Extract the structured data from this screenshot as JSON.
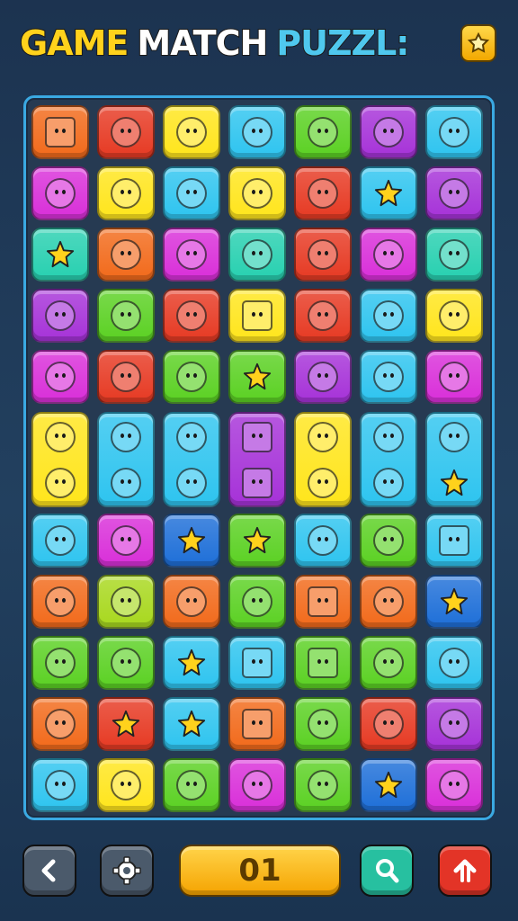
{
  "title": {
    "part1": "GAME",
    "part2": "MATCH",
    "part3": "PUZZL:"
  },
  "score": {
    "value": "01"
  },
  "colors": {
    "orange": "#f26a1b",
    "red": "#e63a23",
    "yellow": "#ffe51c",
    "cyan": "#2ec4ef",
    "green": "#5bd123",
    "purple": "#a632d8",
    "magenta": "#d92fd9",
    "teal": "#27d0b0",
    "lime": "#a8d81e",
    "blue": "#1e6fd8",
    "pink": "#ff4f9a"
  },
  "board": {
    "rows": [
      [
        "orange",
        "red",
        "yellow",
        "cyan",
        "green",
        "purple",
        "cyan"
      ],
      [
        "magenta",
        "yellow",
        "cyan",
        "yellow",
        "red",
        "cyan",
        "purple"
      ],
      [
        "teal",
        "orange",
        "magenta",
        "teal",
        "red",
        "magenta",
        "teal"
      ],
      [
        "purple",
        "green",
        "red",
        "yellow",
        "red",
        "cyan",
        "yellow"
      ],
      [
        "magenta",
        "red",
        "green",
        "green",
        "purple",
        "cyan",
        "magenta"
      ],
      [
        "yellow",
        "cyan",
        "cyan",
        "purple",
        "yellow",
        "cyan",
        "cyan"
      ],
      [
        "cyan",
        "magenta",
        "blue",
        "green",
        "cyan",
        "green",
        "cyan"
      ],
      [
        "orange",
        "lime",
        "orange",
        "green",
        "orange",
        "orange",
        "blue"
      ],
      [
        "green",
        "green",
        "cyan",
        "cyan",
        "green",
        "green",
        "cyan"
      ],
      [
        "orange",
        "red",
        "cyan",
        "orange",
        "green",
        "red",
        "purple"
      ],
      [
        "cyan",
        "yellow",
        "green",
        "magenta",
        "green",
        "blue",
        "magenta"
      ]
    ],
    "icons": [
      [
        "card-icon",
        "bomb-icon",
        "blob-icon",
        "heart-icon",
        "sun-icon",
        "cat-icon",
        "face-icon"
      ],
      [
        "drop-icon",
        "gear-icon",
        "coin-icon",
        "leaf-icon",
        "cat-icon",
        "star-icon",
        "cat-icon"
      ],
      [
        "star-icon",
        "ball-icon",
        "bird-icon",
        "fox-icon",
        "heart-icon",
        "mask-icon",
        "chick-icon"
      ],
      [
        "fruit-icon",
        "pear-icon",
        "balloon-icon",
        "box-icon",
        "sun-icon",
        "pen-icon",
        "pen-icon"
      ],
      [
        "cat-icon",
        "fish-icon",
        "shell-icon",
        "star-icon",
        "pen-icon",
        "swirl-icon",
        "cat-icon"
      ],
      [
        "owl-icon",
        "fox-icon",
        "egg-icon",
        "box-icon",
        "berry-icon",
        "swirl-icon",
        "face-icon"
      ],
      [
        "swirl-icon",
        "pen-icon",
        "star-icon",
        "star-icon",
        "gear-icon",
        "face-icon",
        "screen-icon"
      ],
      [
        "flag-icon",
        "swirl-icon",
        "house-icon",
        "ball-icon",
        "card-icon",
        "gear-icon",
        "star-icon"
      ],
      [
        "balloon-icon",
        "pen-icon",
        "star-icon",
        "grid-icon",
        "note-icon",
        "face-icon",
        "fish-icon"
      ],
      [
        "face-icon",
        "star-icon",
        "star-icon",
        "box-icon",
        "gear-icon",
        "ball-icon",
        "swirl-icon"
      ],
      [
        "sun-icon",
        "gear-icon",
        "shell-icon",
        "cat-icon",
        "sun-icon",
        "star-icon",
        "face-icon"
      ]
    ],
    "tall_lower_icons": [
      "ball-icon",
      "pear-icon",
      "drop-icon",
      "box-icon",
      "berry-icon",
      "ring-icon",
      "star-icon"
    ]
  },
  "toolbar": [
    {
      "name": "back-button",
      "icon": "back-arrow-icon",
      "color": "#4b5a6b"
    },
    {
      "name": "settings-button",
      "icon": "gear-icon",
      "color": "#4b5a6b"
    },
    {
      "name": "hint-button",
      "icon": "magnifier-icon",
      "color": "#27c0a0"
    },
    {
      "name": "boost-button",
      "icon": "up-arrow-icon",
      "color": "#e33427"
    }
  ]
}
